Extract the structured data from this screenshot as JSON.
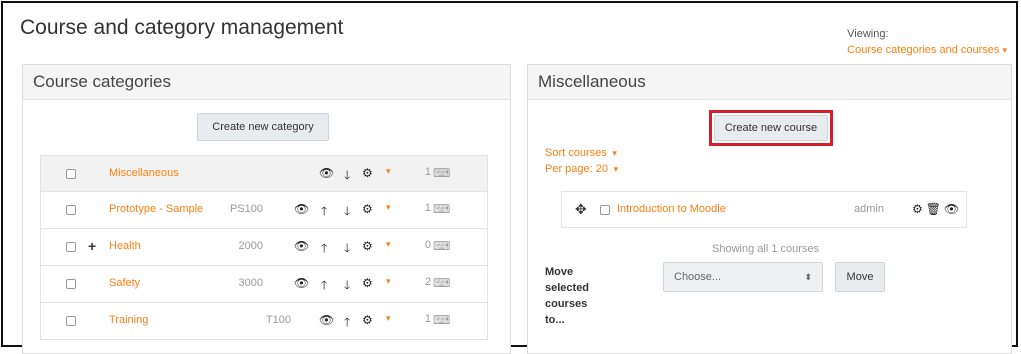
{
  "header": {
    "title": "Course and category management",
    "viewing_label": "Viewing:",
    "viewing_value": "Course categories and courses"
  },
  "categories_panel": {
    "title": "Course categories",
    "create_button": "Create new category",
    "rows": [
      {
        "name": "Miscellaneous",
        "id": "",
        "count": "1"
      },
      {
        "name": "Prototype - Sample",
        "id": "PS100",
        "count": "1"
      },
      {
        "name": "Health",
        "id": "2000",
        "count": "0"
      },
      {
        "name": "Safety",
        "id": "3000",
        "count": "2"
      },
      {
        "name": "Training",
        "id": "T100",
        "count": "1"
      }
    ]
  },
  "courses_panel": {
    "title": "Miscellaneous",
    "create_button": "Create new course",
    "sort_label": "Sort courses",
    "per_page_label": "Per page: 20",
    "courses": [
      {
        "name": "Introduction to Moodle",
        "owner": "admin"
      }
    ],
    "showing_text": "Showing all 1 courses",
    "move_label": "Move selected courses to...",
    "select_placeholder": "Choose...",
    "move_button": "Move"
  },
  "colors": {
    "accent": "#f98012",
    "highlight": "#d0202d"
  }
}
